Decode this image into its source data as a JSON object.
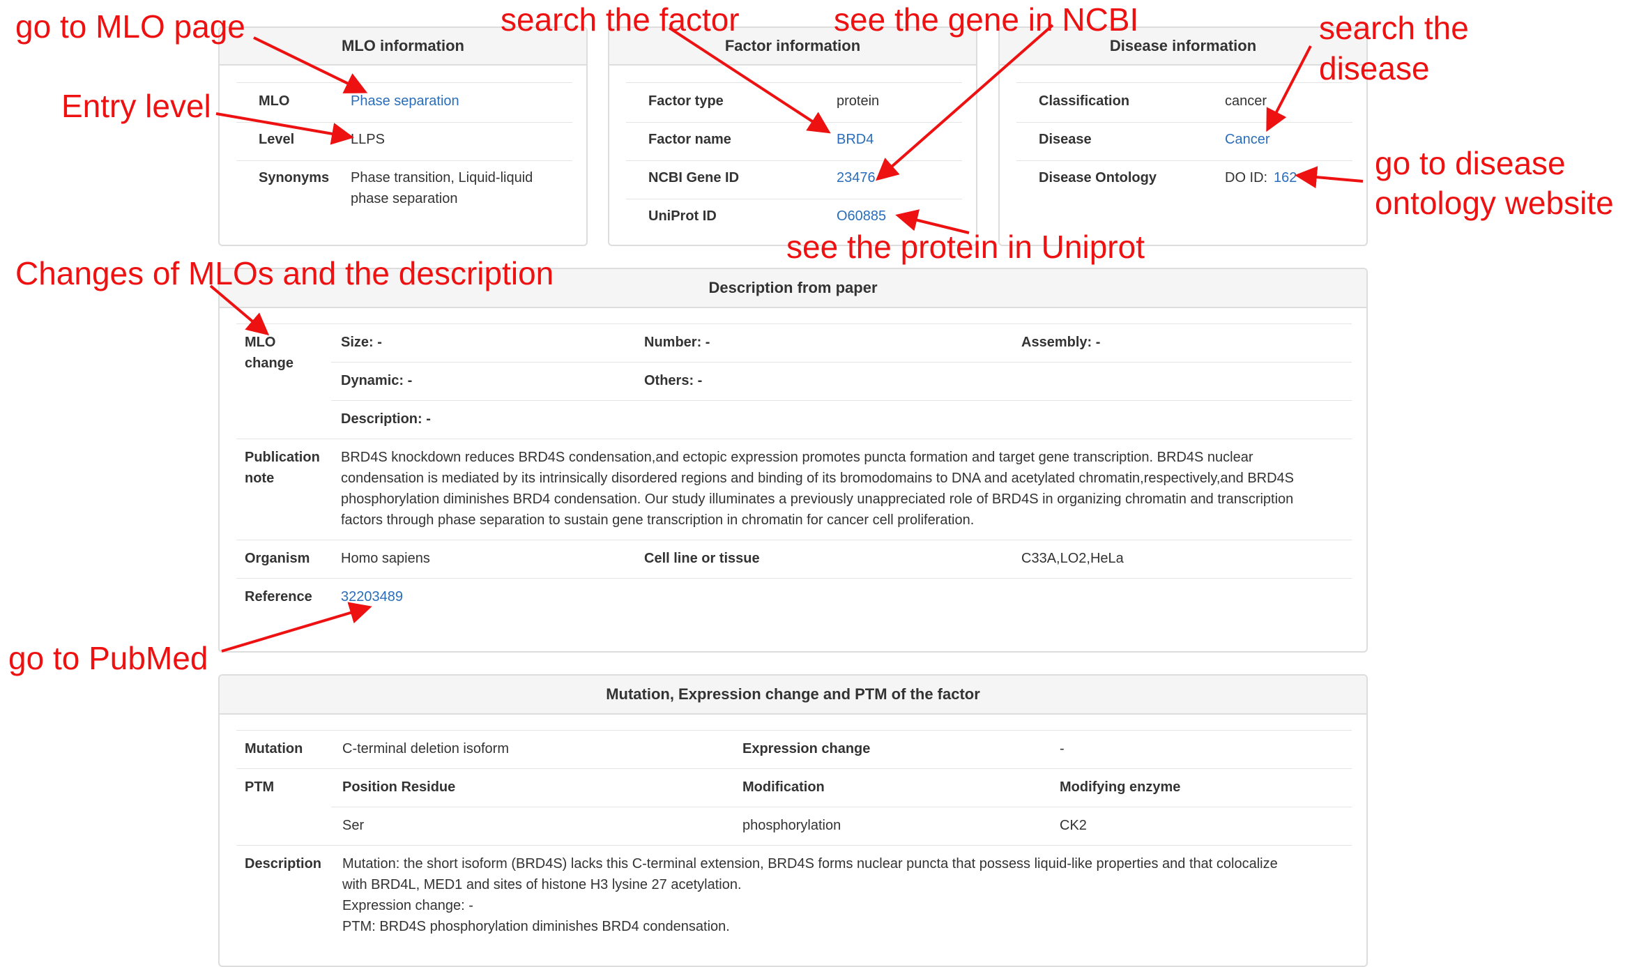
{
  "mlo_panel": {
    "title": "MLO information",
    "mlo_label": "MLO",
    "mlo_value": "Phase separation",
    "level_label": "Level",
    "level_value": "LLPS",
    "synonyms_label": "Synonyms",
    "synonyms_line1": "Phase transition, Liquid-liquid",
    "synonyms_line2": "phase separation"
  },
  "factor_panel": {
    "title": "Factor information",
    "type_label": "Factor type",
    "type_value": "protein",
    "name_label": "Factor name",
    "name_value": "BRD4",
    "gene_label": "NCBI Gene ID",
    "gene_value": "23476",
    "uniprot_label": "UniProt ID",
    "uniprot_value": "O60885"
  },
  "disease_panel": {
    "title": "Disease information",
    "class_label": "Classification",
    "class_value": "cancer",
    "disease_label": "Disease",
    "disease_value": "Cancer",
    "ontology_label": "Disease Ontology",
    "ontology_prefix": "DO ID:",
    "ontology_value": "162"
  },
  "description_panel": {
    "title": "Description from paper",
    "mlo_change_line1": "MLO",
    "mlo_change_line2": "change",
    "size": "Size: -",
    "number": "Number: -",
    "assembly": "Assembly: -",
    "dynamic": "Dynamic: -",
    "others": "Others: -",
    "description": "Description: -",
    "pub_note_line1": "Publication",
    "pub_note_line2": "note",
    "pub_text": [
      "BRD4S knockdown reduces BRD4S condensation,and ectopic expression promotes puncta formation and target gene transcription. BRD4S nuclear",
      "condensation is mediated by its intrinsically disordered regions and binding of its bromodomains to DNA and acetylated chromatin,respectively,and BRD4S",
      "phosphorylation diminishes BRD4 condensation. Our study illuminates a previously unappreciated role of BRD4S in organizing chromatin and transcription",
      "factors through phase separation to sustain gene transcription in chromatin for cancer cell proliferation."
    ],
    "organism_label": "Organism",
    "organism_value": "Homo sapiens",
    "cell_label": "Cell line or tissue",
    "cell_value": "C33A,LO2,HeLa",
    "reference_label": "Reference",
    "reference_value": "32203489"
  },
  "mutation_panel": {
    "title": "Mutation, Expression change and PTM of the factor",
    "mutation_label": "Mutation",
    "mutation_value": "C-terminal deletion isoform",
    "expression_label": "Expression change",
    "expression_value": "-",
    "ptm_label": "PTM",
    "position_header": "Position Residue",
    "modification_header": "Modification",
    "enzyme_header": "Modifying enzyme",
    "position_value": "Ser",
    "modification_value": "phosphorylation",
    "enzyme_value": "CK2",
    "description_label": "Description",
    "description_lines": [
      "Mutation: the short isoform (BRD4S) lacks this C-terminal extension, BRD4S forms nuclear puncta that possess liquid-like properties and that colocalize",
      "with BRD4L, MED1 and sites of histone H3 lysine 27 acetylation.",
      "Expression change: -",
      "PTM: BRD4S phosphorylation diminishes BRD4 condensation."
    ]
  },
  "annotations": {
    "go_mlo": "go to MLO page",
    "entry_level": "Entry level",
    "search_factor": "search the factor",
    "see_gene": "see the gene in NCBI",
    "search_disease_1": "search the",
    "search_disease_2": "disease",
    "go_ontology_1": "go to disease",
    "go_ontology_2": "ontology website",
    "see_protein": "see the protein in Uniprot",
    "changes_mlo": "Changes of MLOs and the description",
    "go_pubmed": "go to PubMed",
    "color": "#ee1111"
  },
  "colors": {
    "link": "#2a6ebb",
    "header_bg": "#f5f5f5",
    "border": "#dddddd"
  }
}
